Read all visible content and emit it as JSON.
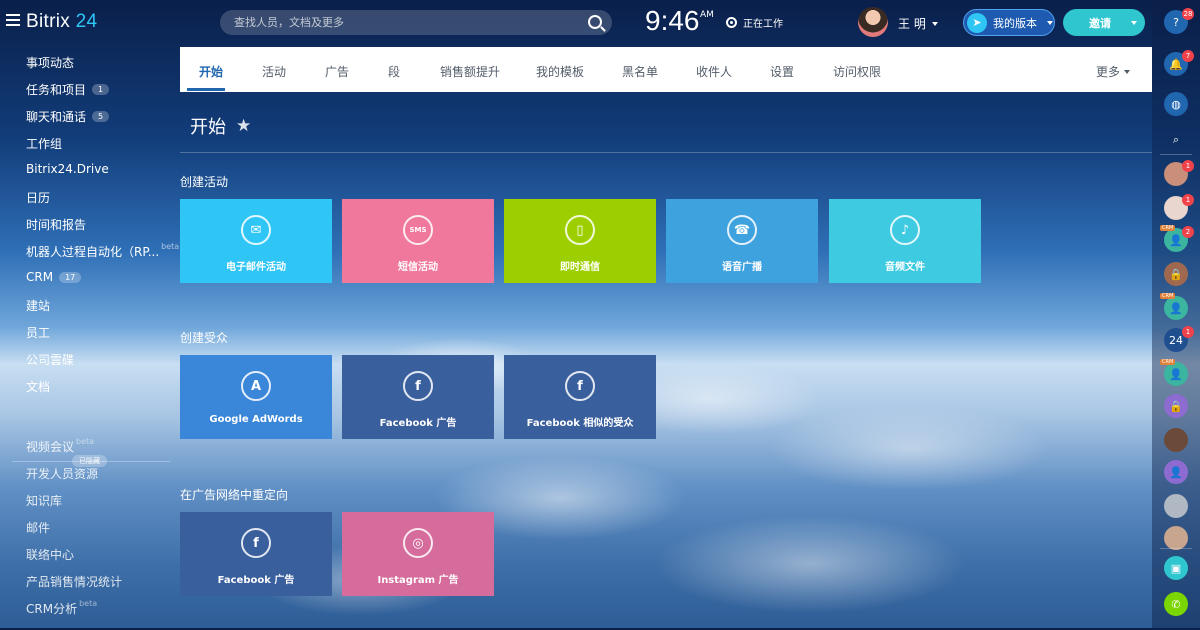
{
  "header": {
    "logo_main": "Bitrix",
    "logo_num": "24",
    "search_placeholder": "查找人员，文档及更多",
    "clock": "9:46",
    "ampm": "AM",
    "work_status": "正在工作",
    "user_name": "王 明",
    "plan_label": "我的版本",
    "invite_label": "邀请"
  },
  "sidebar": {
    "items": [
      {
        "label": "事项动态"
      },
      {
        "label": "任务和项目",
        "counter": "1"
      },
      {
        "label": "聊天和通话",
        "counter": "5"
      },
      {
        "label": "工作组"
      },
      {
        "label": "Bitrix24.Drive"
      },
      {
        "label": "日历"
      },
      {
        "label": "时间和报告"
      },
      {
        "label": "机器人过程自动化（RP...",
        "beta": "beta"
      },
      {
        "label": "CRM",
        "counter": "17"
      },
      {
        "label": "建站"
      },
      {
        "label": "员工"
      },
      {
        "label": "公司雲碟"
      },
      {
        "label": "文档"
      }
    ],
    "hidden_label": "已隐藏",
    "hidden_items": [
      {
        "label": "视频会议",
        "beta": "beta"
      },
      {
        "label": "开发人员资源"
      },
      {
        "label": "知识库"
      },
      {
        "label": "邮件"
      },
      {
        "label": "联络中心"
      },
      {
        "label": "产品销售情况统计"
      },
      {
        "label": "CRM分析",
        "beta": "beta"
      }
    ]
  },
  "tabs": {
    "items": [
      "开始",
      "活动",
      "广告",
      "段",
      "销售额提升",
      "我的模板",
      "黑名单",
      "收件人",
      "设置",
      "访问权限"
    ],
    "more": "更多"
  },
  "main": {
    "title": "开始",
    "sections": [
      {
        "title": "创建活动",
        "tiles": [
          {
            "label": "电子邮件活动",
            "icon": "email-icon",
            "color": "#2fc6f6"
          },
          {
            "label": "短信活动",
            "icon": "sms-icon",
            "color": "#f0789c"
          },
          {
            "label": "即时通信",
            "icon": "phone-icon",
            "color": "#9dcf00"
          },
          {
            "label": "语音广播",
            "icon": "call-icon",
            "color": "#3ea2df"
          },
          {
            "label": "音频文件",
            "icon": "audio-icon",
            "color": "#3ecae0"
          }
        ]
      },
      {
        "title": "创建受众",
        "tiles": [
          {
            "label": "Google AdWords",
            "icon": "adwords-icon",
            "color": "#3a86d8"
          },
          {
            "label": "Facebook 广告",
            "icon": "facebook-icon",
            "color": "#3a5f9d"
          },
          {
            "label": "Facebook 相似的受众",
            "icon": "facebook-icon",
            "color": "#3a5f9d"
          }
        ]
      },
      {
        "title": "在广告网络中重定向",
        "tiles": [
          {
            "label": "Facebook 广告",
            "icon": "facebook-icon",
            "color": "#3a5f9d"
          },
          {
            "label": "Instagram 广告",
            "icon": "instagram-icon",
            "color": "#d56c9c"
          }
        ]
      }
    ]
  },
  "rightbar": {
    "help_badge": "28",
    "notify_badge": "7",
    "chat_badges": [
      "1",
      "1",
      "2",
      "",
      "",
      "1"
    ],
    "crm_tag": "CRM",
    "chat24_label": "24"
  }
}
